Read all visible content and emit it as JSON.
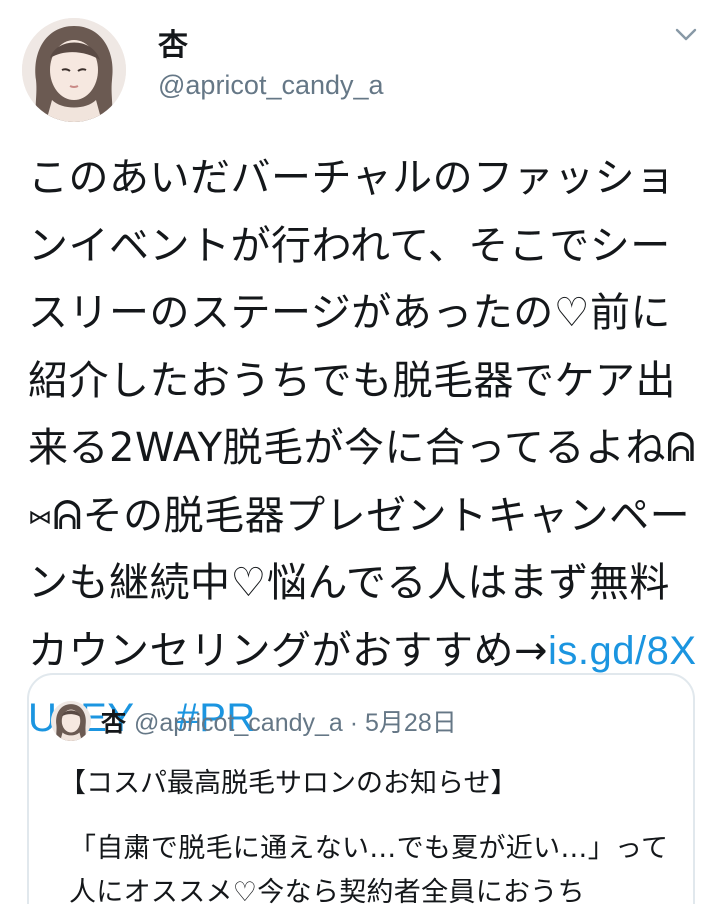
{
  "tweet": {
    "author_name": "杏",
    "author_handle": "@apricot_candy_a",
    "menu_icon": "chevron-down-icon",
    "body_text": "このあいだバーチャルのファッションイベントが行われて、そこでシースリーのステージがあったの♡前に紹介したおうちでも脱毛器でケア出来る2WAY脱毛が今に合ってるよねᕱ⑅ᕱその脱毛器プレゼントキャンペーンも継続中♡悩んでる人はまず無料カウンセリングがおすすめ→",
    "link_text": "is.gd/8XU1EY",
    "hashtag": "#PR"
  },
  "quote": {
    "author_name": "杏",
    "author_handle": "@apricot_candy_a",
    "separator": " · ",
    "date": "5月28日",
    "title": "【コスパ最高脱毛サロンのお知らせ】",
    "body_line1": "「自粛で脱毛に通えない…でも夏が近い…」って人にオススメ♡今なら契約者全員におうち"
  },
  "colors": {
    "text": "#14171a",
    "secondary": "#657786",
    "link": "#1b95e0",
    "border": "#e1e8ed"
  }
}
